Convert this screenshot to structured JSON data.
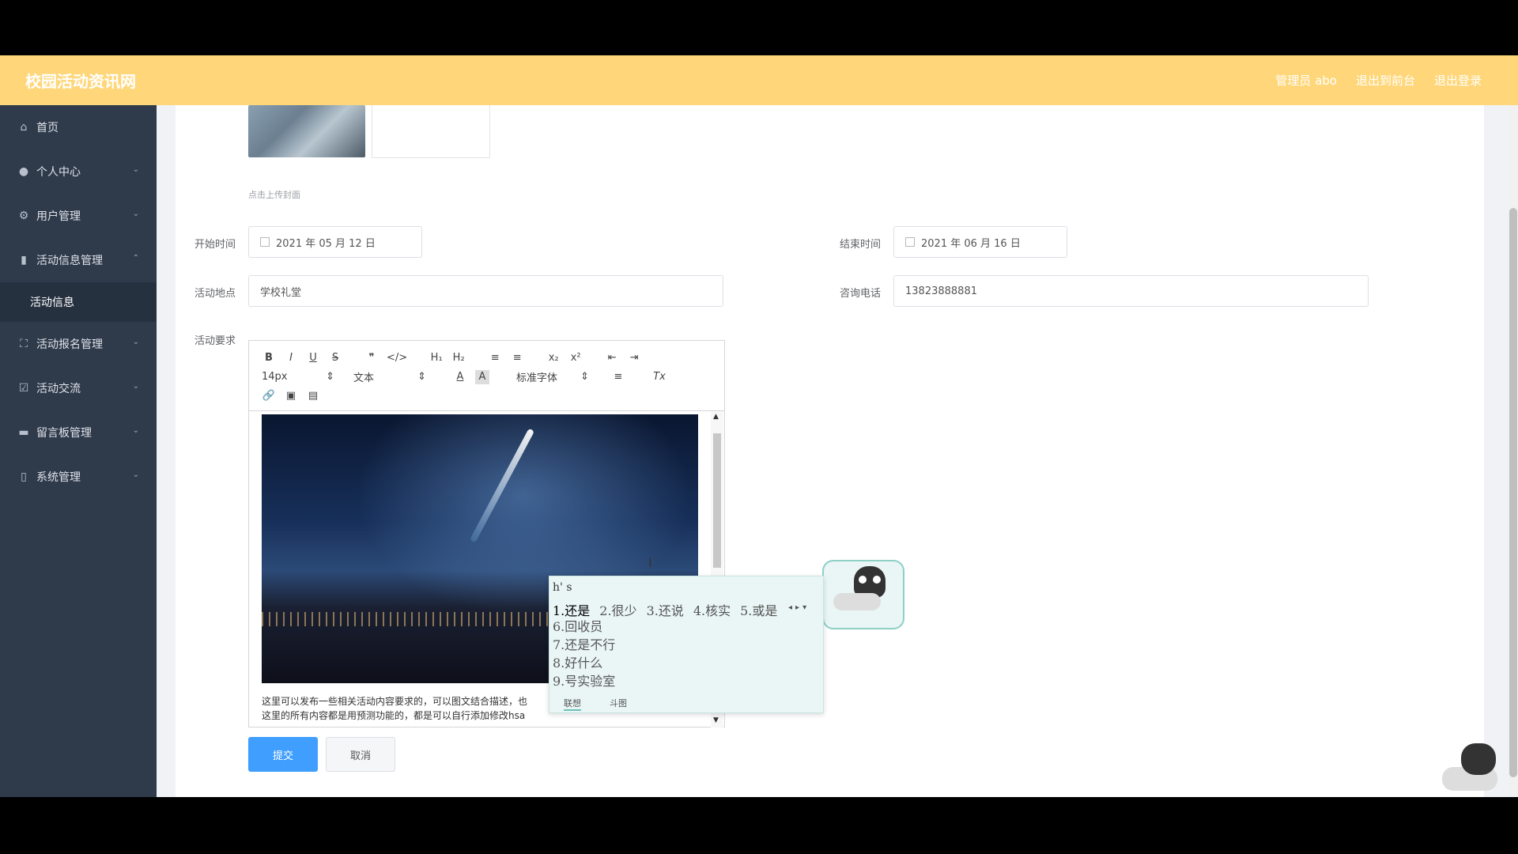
{
  "header": {
    "brand": "校园活动资讯网",
    "admin_label": "管理员 abo",
    "back_to_front": "退出到前台",
    "logout": "退出登录"
  },
  "sidebar": {
    "items": [
      {
        "label": "首页",
        "icon": "home-icon"
      },
      {
        "label": "个人中心",
        "icon": "user-icon"
      },
      {
        "label": "用户管理",
        "icon": "settings-icon"
      },
      {
        "label": "活动信息管理",
        "icon": "bar-chart-icon",
        "sub": "活动信息"
      },
      {
        "label": "活动报名管理",
        "icon": "expand-icon"
      },
      {
        "label": "活动交流",
        "icon": "checklist-icon"
      },
      {
        "label": "留言板管理",
        "icon": "monitor-icon"
      },
      {
        "label": "系统管理",
        "icon": "phone-icon"
      }
    ]
  },
  "form": {
    "cover_hint": "点击上传封面",
    "start_label": "开始时间",
    "start_value": "2021 年 05 月 12 日",
    "end_label": "结束时间",
    "end_value": "2021 年 06 月 16 日",
    "location_label": "活动地点",
    "location_value": "学校礼堂",
    "phone_label": "咨询电话",
    "phone_value": "13823888881",
    "requirements_label": "活动要求"
  },
  "editor": {
    "toolbar": {
      "bold": "B",
      "italic": "I",
      "underline": "U",
      "strike": "S",
      "quote": "❞",
      "code": "</>",
      "h1": "H₁",
      "h2": "H₂",
      "ol": "≡",
      "ul": "≡",
      "sub": "x₂",
      "sup": "x²",
      "outdent": "⇤",
      "indent": "⇥",
      "size": "14px",
      "header": "文本",
      "color": "A",
      "bg": "A",
      "font": "标准字体",
      "align": "≡",
      "clear": "Tx",
      "link": "🔗",
      "image": "▣",
      "video": "▤"
    },
    "text_line1": "这里可以发布一些相关活动内容要求的，可以图文结合描述，也",
    "text_line2": "这里的所有内容都是用预测功能的，都是可以自行添加修改hsa"
  },
  "buttons": {
    "submit": "提交",
    "cancel": "取消"
  },
  "ime": {
    "pinyin": "h' s",
    "candidates": [
      "1.还是",
      "2.很少",
      "3.还说",
      "4.核实",
      "5.或是"
    ],
    "more": [
      "6.回收员",
      "7.还是不行",
      "8.好什么",
      "9.号实验室"
    ],
    "tab_assoc": "联想",
    "tab_fight": "斗图"
  }
}
